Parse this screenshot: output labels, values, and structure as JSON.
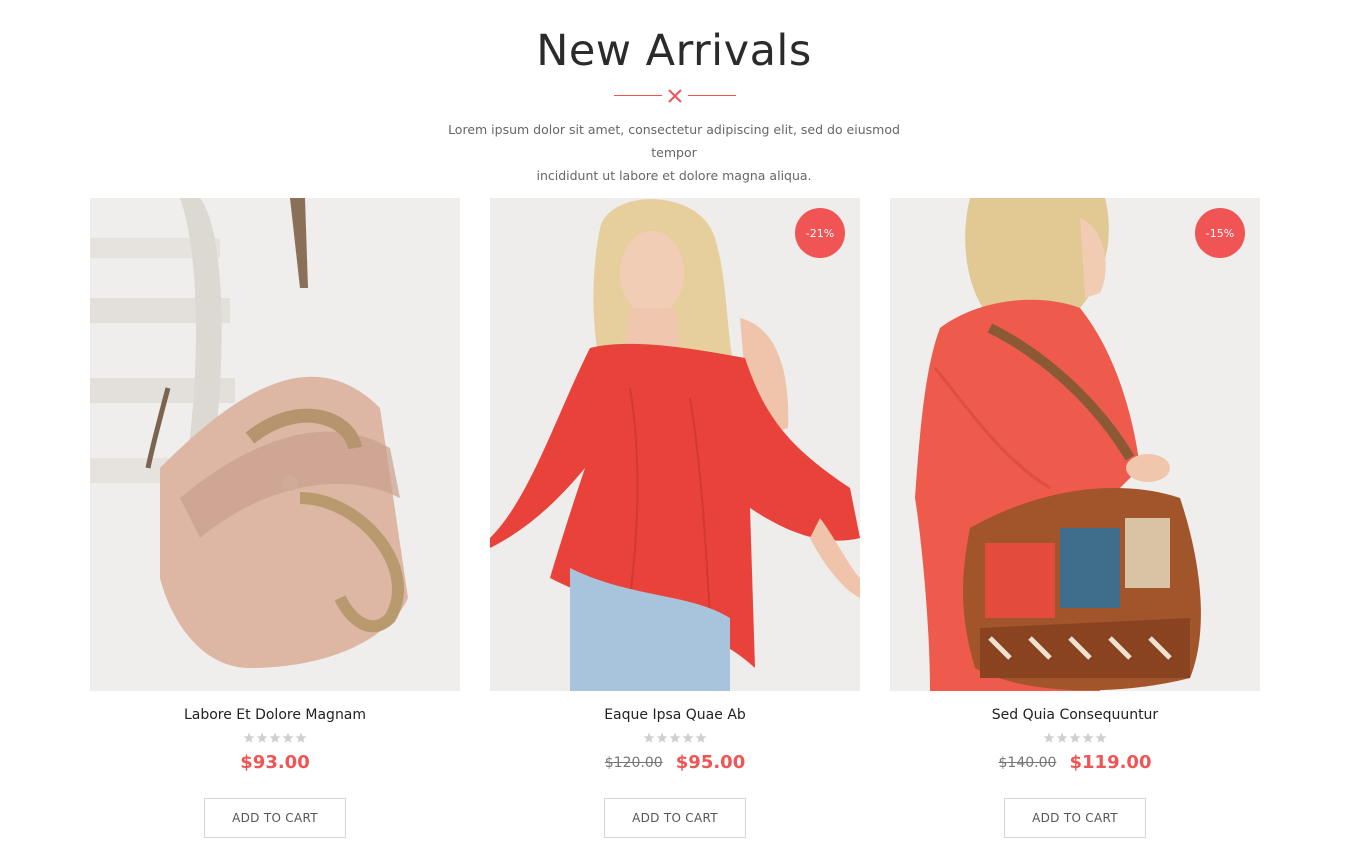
{
  "section": {
    "title": "New Arrivals",
    "subtitle_line1": "Lorem ipsum dolor sit amet, consectetur adipiscing elit, sed do eiusmod tempor",
    "subtitle_line2": "incididunt ut labore et dolore magna aliqua."
  },
  "colors": {
    "accent": "#f05454",
    "text": "#2b2b2b",
    "muted": "#666666",
    "star": "#cfcfcf"
  },
  "products": [
    {
      "name": "Labore Et Dolore Magnam",
      "rating": 0,
      "old_price": "",
      "price": "$93.00",
      "badge": "",
      "button": "ADD TO CART",
      "image": "leather-bag-image"
    },
    {
      "name": "Eaque Ipsa Quae Ab",
      "rating": 0,
      "old_price": "$120.00",
      "price": "$95.00",
      "badge": "-21%",
      "button": "ADD TO CART",
      "image": "red-blouse-model-image"
    },
    {
      "name": "Sed Quia Consequuntur",
      "rating": 0,
      "old_price": "$140.00",
      "price": "$119.00",
      "badge": "-15%",
      "button": "ADD TO CART",
      "image": "patchwork-bag-model-image"
    }
  ]
}
